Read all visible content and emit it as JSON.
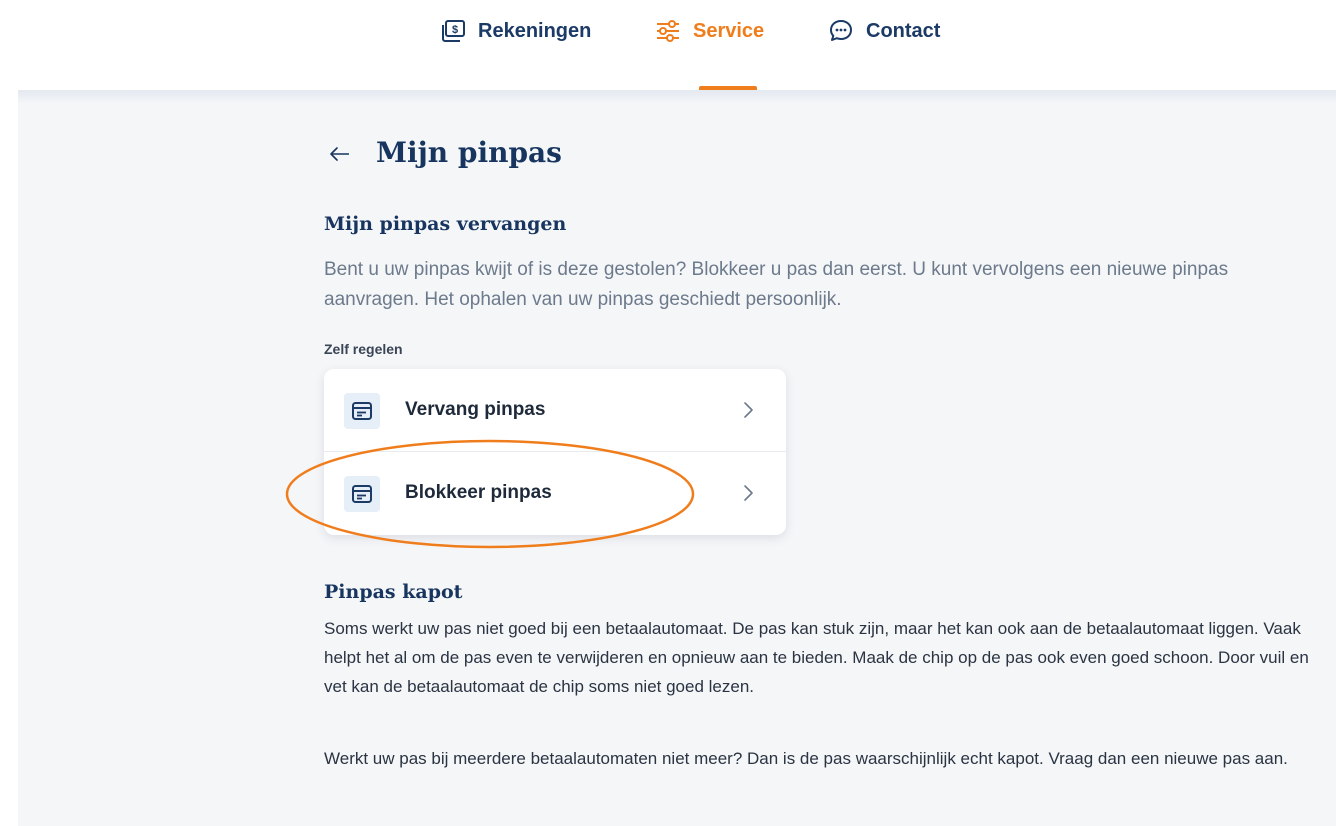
{
  "nav": {
    "items": [
      {
        "label": "Rekeningen",
        "icon": "bank-statement-icon",
        "active": false
      },
      {
        "label": "Service",
        "icon": "sliders-icon",
        "active": true
      },
      {
        "label": "Contact",
        "icon": "chat-bubble-icon",
        "active": false
      }
    ]
  },
  "page": {
    "title": "Mijn pinpas"
  },
  "vervangen": {
    "title": "Mijn pinpas vervangen",
    "intro": "Bent u uw pinpas kwijt of is deze gestolen? Blokkeer u pas dan eerst. U kunt vervolgens een nieuwe pinpas aanvragen. Het ophalen van uw pinpas geschiedt persoonlijk.",
    "self_service_label": "Zelf regelen",
    "actions": [
      {
        "label": "Vervang pinpas",
        "icon": "card-icon"
      },
      {
        "label": "Blokkeer pinpas",
        "icon": "card-icon",
        "highlighted": true
      }
    ]
  },
  "kapot": {
    "title": "Pinpas kapot",
    "paragraphs": [
      "Soms werkt uw pas niet goed bij een betaalautomaat. De pas kan stuk zijn, maar het kan ook aan de betaalautomaat liggen. Vaak helpt het al om de pas even te verwijderen en opnieuw aan te bieden. Maak de chip op de pas ook even goed schoon. Door vuil en vet kan de betaalautomaat de chip soms niet goed lezen.",
      "Werkt uw pas bij meerdere betaalautomaten niet meer? Dan is de pas waarschijnlijk echt kapot. Vraag dan een nieuwe pas aan."
    ]
  },
  "colors": {
    "brand_navy": "#17355f",
    "accent_orange": "#f07d1c",
    "background": "#f5f6f8",
    "muted_text": "#6c7a8c"
  }
}
